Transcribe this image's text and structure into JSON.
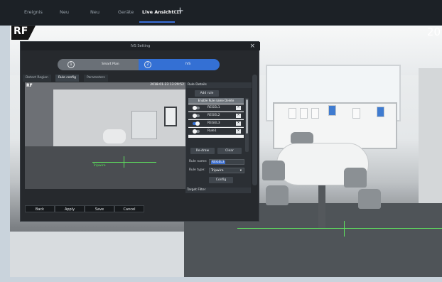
{
  "top_tabs": [
    {
      "label": "Ereignis"
    },
    {
      "label": "Neu"
    },
    {
      "label": "Neu"
    },
    {
      "label": "Geräte"
    },
    {
      "label": "Live Ansicht(1)"
    }
  ],
  "live_view": {
    "logo": "RF",
    "corner_text": "20"
  },
  "dialog": {
    "title": "IVS Setting",
    "steps": [
      {
        "num": "1",
        "label": "Smart Plan"
      },
      {
        "num": "2",
        "label": "IVS"
      }
    ],
    "subtabs": [
      "Detect Region",
      "Rule config",
      "Parameters"
    ],
    "preview": {
      "logo": "RF",
      "timestamp": "2018-01-23 13:29:52",
      "tripwire_label": "Tripwire"
    },
    "rule_details": {
      "header": "Rule Details",
      "add_rule": "Add rule",
      "columns": "Enable  Rule name  Delete",
      "rules": [
        {
          "name": "REGEL1",
          "enabled": false
        },
        {
          "name": "REGEL2",
          "enabled": false
        },
        {
          "name": "REGEL3",
          "enabled": true
        },
        {
          "name": "Rule1",
          "enabled": false
        }
      ],
      "redraw": "Re-draw",
      "clear": "Clear",
      "rule_name_label": "Rule name:",
      "rule_name_value": "REGEL3",
      "rule_type_label": "Rule type:",
      "rule_type_value": "Tripwire",
      "config": "Config",
      "target_filter": "Target Filter"
    },
    "buttons": {
      "back": "Back",
      "apply": "Apply",
      "save": "Save",
      "cancel": "Cancel"
    }
  }
}
